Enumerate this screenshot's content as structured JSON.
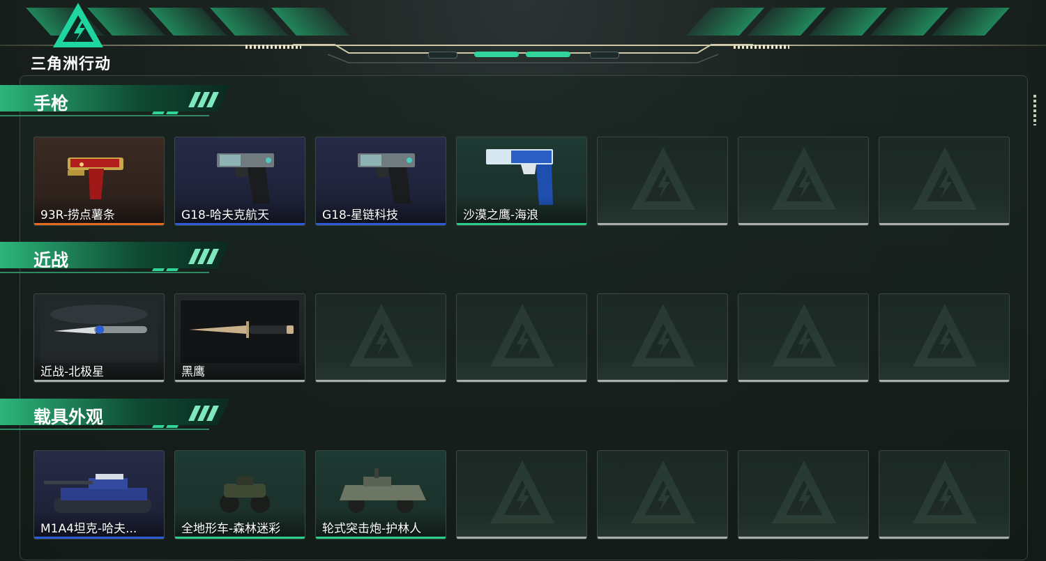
{
  "app": {
    "logo_text": "三角洲行动"
  },
  "colors": {
    "accent": "#31d49a",
    "orange": "#e06a1f",
    "blue": "#2f5bd6",
    "green": "#2ad08a",
    "gray": "#a9adab"
  },
  "sections": [
    {
      "title": "手枪",
      "items": [
        {
          "name": "93R-捞点薯条",
          "rarity": "orange",
          "icon": "pistol-red-icon"
        },
        {
          "name": "G18-哈夫克航天",
          "rarity": "blue",
          "icon": "pistol-black-icon"
        },
        {
          "name": "G18-星链科技",
          "rarity": "blue",
          "icon": "pistol-black-icon"
        },
        {
          "name": "沙漠之鹰-海浪",
          "rarity": "green",
          "icon": "pistol-wave-icon"
        },
        {
          "name": "",
          "rarity": "empty"
        },
        {
          "name": "",
          "rarity": "empty"
        },
        {
          "name": "",
          "rarity": "empty"
        }
      ]
    },
    {
      "title": "近战",
      "items": [
        {
          "name": "近战-北极星",
          "rarity": "gray",
          "icon": "knife-icon"
        },
        {
          "name": "黑鹰",
          "rarity": "gray",
          "icon": "dagger-icon"
        },
        {
          "name": "",
          "rarity": "empty"
        },
        {
          "name": "",
          "rarity": "empty"
        },
        {
          "name": "",
          "rarity": "empty"
        },
        {
          "name": "",
          "rarity": "empty"
        },
        {
          "name": "",
          "rarity": "empty"
        }
      ]
    },
    {
      "title": "载具外观",
      "items": [
        {
          "name": "M1A4坦克-哈夫...",
          "rarity": "blue",
          "icon": "tank-icon"
        },
        {
          "name": "全地形车-森林迷彩",
          "rarity": "green",
          "icon": "atv-icon"
        },
        {
          "name": "轮式突击炮-护林人",
          "rarity": "green",
          "icon": "armored-vehicle-icon"
        },
        {
          "name": "",
          "rarity": "empty"
        },
        {
          "name": "",
          "rarity": "empty"
        },
        {
          "name": "",
          "rarity": "empty"
        },
        {
          "name": "",
          "rarity": "empty"
        }
      ]
    }
  ]
}
